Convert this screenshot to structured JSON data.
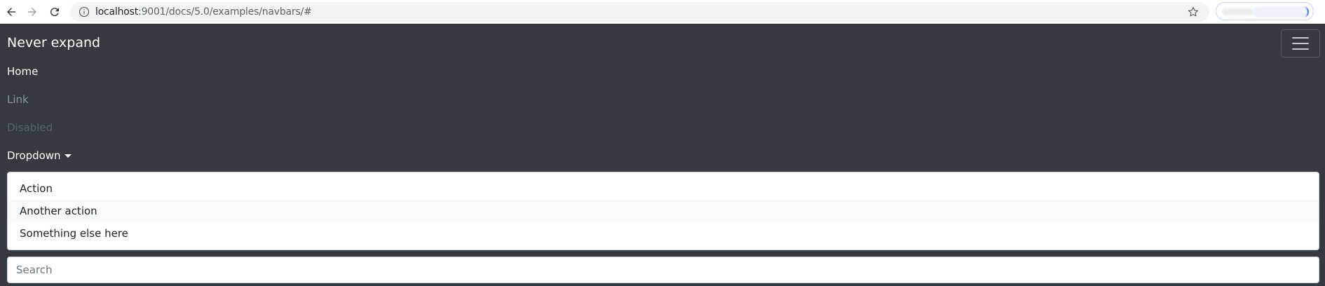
{
  "browser": {
    "url_host": "localhost",
    "url_path": ":9001/docs/5.0/examples/navbars/#"
  },
  "navbar": {
    "brand": "Never expand",
    "items": [
      {
        "label": "Home"
      },
      {
        "label": "Link"
      },
      {
        "label": "Disabled"
      },
      {
        "label": "Dropdown"
      }
    ]
  },
  "dropdown": {
    "items": [
      "Action",
      "Another action",
      "Something else here"
    ]
  },
  "search": {
    "placeholder": "Search"
  },
  "colors": {
    "navbar_bg": "#343a40",
    "active_link": "#ffffff",
    "link": "#8f969c",
    "disabled_link": "#5a6168"
  }
}
